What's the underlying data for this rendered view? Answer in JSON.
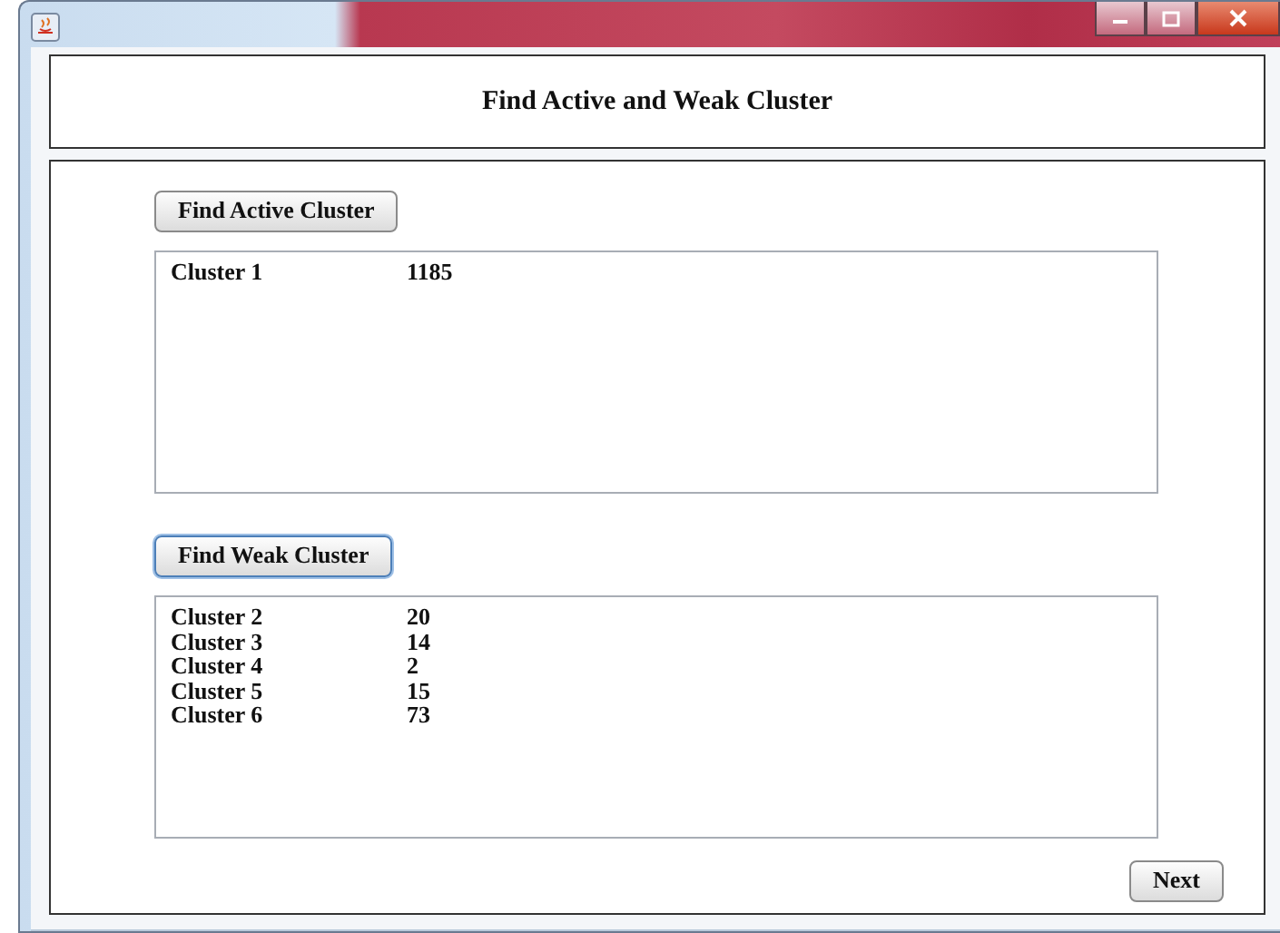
{
  "header": {
    "title": "Find Active and Weak Cluster"
  },
  "sections": [
    {
      "button": {
        "label": "Find Active Cluster",
        "focused": false
      },
      "rows": [
        {
          "name": "Cluster 1",
          "value": "1185"
        }
      ]
    },
    {
      "button": {
        "label": "Find Weak Cluster",
        "focused": true
      },
      "rows": [
        {
          "name": "Cluster 2",
          "value": "20"
        },
        {
          "name": "Cluster 3",
          "value": "14"
        },
        {
          "name": "Cluster 4",
          "value": "2"
        },
        {
          "name": "Cluster 5",
          "value": "15"
        },
        {
          "name": "Cluster 6",
          "value": "73"
        }
      ]
    }
  ],
  "footer": {
    "button": "Next"
  }
}
